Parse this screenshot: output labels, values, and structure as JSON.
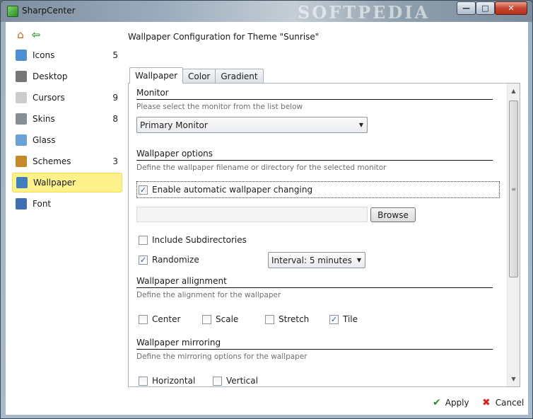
{
  "window": {
    "title": "SharpCenter",
    "watermark": "SOFTPEDIA",
    "minimize_glyph": "—",
    "maximize_glyph": "□",
    "close_glyph": "✕"
  },
  "nav": {
    "home_icon": "home-icon",
    "back_icon": "back-arrow-icon",
    "items": [
      {
        "label": "Icons",
        "count": "5",
        "icon": "icons-icon",
        "color": "#4f8fd1"
      },
      {
        "label": "Desktop",
        "count": "",
        "icon": "desktop-icon",
        "color": "#777777"
      },
      {
        "label": "Cursors",
        "count": "9",
        "icon": "cursor-icon",
        "color": "#cccccc"
      },
      {
        "label": "Skins",
        "count": "8",
        "icon": "skins-icon",
        "color": "#8a8f96"
      },
      {
        "label": "Glass",
        "count": "",
        "icon": "glass-icon",
        "color": "#6aa2d8"
      },
      {
        "label": "Schemes",
        "count": "3",
        "icon": "brush-icon",
        "color": "#c58a2a"
      },
      {
        "label": "Wallpaper",
        "count": "",
        "icon": "wallpaper-icon",
        "color": "#3f7fbf"
      },
      {
        "label": "Font",
        "count": "",
        "icon": "font-icon",
        "color": "#3f6fb0"
      }
    ],
    "selected": "Wallpaper"
  },
  "heading": "Wallpaper Configuration for Theme \"Sunrise\"",
  "tabs": [
    "Wallpaper",
    "Color",
    "Gradient"
  ],
  "active_tab": "Wallpaper",
  "monitor": {
    "title": "Monitor",
    "description": "Please select the monitor from the list below",
    "selected": "Primary Monitor"
  },
  "wallpaper_options": {
    "title": "Wallpaper options",
    "description": "Define the wallpaper filename or directory for the selected monitor",
    "enable_label": "Enable automatic wallpaper changing",
    "enable_checked": true,
    "path_value": "",
    "browse_label": "Browse",
    "include_subdirs_label": "Include Subdirectories",
    "include_subdirs_checked": false,
    "randomize_label": "Randomize",
    "randomize_checked": true,
    "interval_selected": "Interval: 5 minutes"
  },
  "alignment": {
    "title": "Wallpaper allignment",
    "description": "Define the alignment for the wallpaper",
    "options": [
      {
        "label": "Center",
        "checked": false
      },
      {
        "label": "Scale",
        "checked": false
      },
      {
        "label": "Stretch",
        "checked": false
      },
      {
        "label": "Tile",
        "checked": true
      }
    ]
  },
  "mirroring": {
    "title": "Wallpaper mirroring",
    "description": "Define the mirroring options for the wallpaper",
    "options": [
      {
        "label": "Horizontal",
        "checked": false
      },
      {
        "label": "Vertical",
        "checked": false
      }
    ]
  },
  "footer": {
    "apply_label": "Apply",
    "cancel_label": "Cancel"
  }
}
